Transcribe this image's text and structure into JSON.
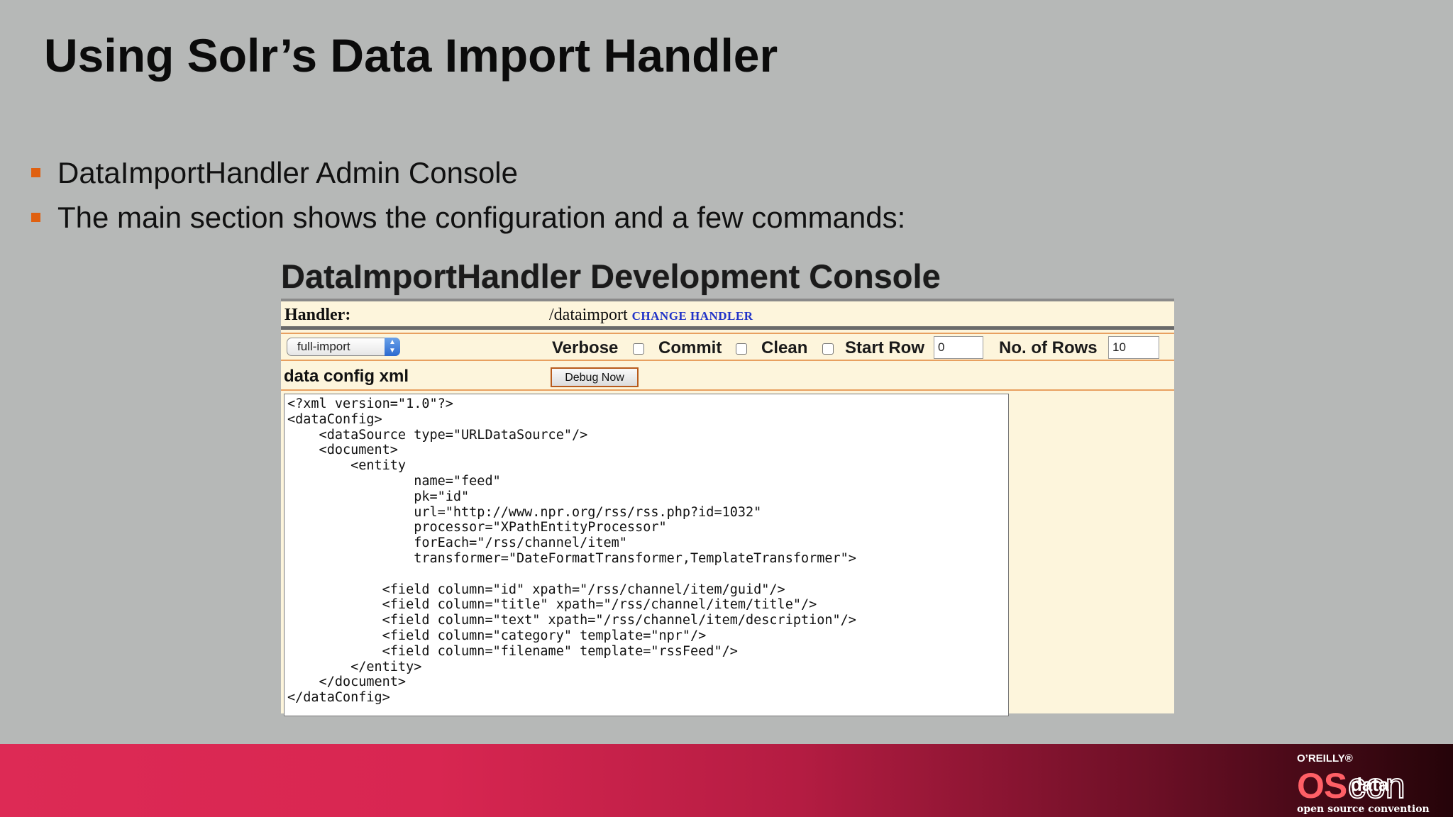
{
  "slide": {
    "title": "Using Solr’s Data Import Handler",
    "bullets": [
      "DataImportHandler Admin Console",
      "The main section shows the configuration and a few commands:"
    ]
  },
  "console": {
    "title": "DataImportHandler Development Console",
    "handler_label": "Handler:",
    "handler_path": "/dataimport",
    "change_handler_link": "CHANGE HANDLER",
    "command_select_value": "full-import",
    "verbose_label": "Verbose",
    "commit_label": "Commit",
    "clean_label": "Clean",
    "start_row_label": "Start Row",
    "start_row_value": "0",
    "rows_label": "No. of Rows",
    "rows_value": "10",
    "config_label": "data config xml",
    "debug_button": "Debug Now",
    "config_xml": "<?xml version=\"1.0\"?>\n<dataConfig>\n    <dataSource type=\"URLDataSource\"/>\n    <document>\n        <entity\n                name=\"feed\"\n                pk=\"id\"\n                url=\"http://www.npr.org/rss/rss.php?id=1032\"\n                processor=\"XPathEntityProcessor\"\n                forEach=\"/rss/channel/item\"\n                transformer=\"DateFormatTransformer,TemplateTransformer\">\n\n            <field column=\"id\" xpath=\"/rss/channel/item/guid\"/>\n            <field column=\"title\" xpath=\"/rss/channel/item/title\"/>\n            <field column=\"text\" xpath=\"/rss/channel/item/description\"/>\n            <field column=\"category\" template=\"npr\"/>\n            <field column=\"filename\" template=\"rssFeed\"/>\n        </entity>\n    </document>\n</dataConfig>"
  },
  "footer": {
    "logo_oreilly": "O’REILLY®",
    "logo_os": "OS",
    "logo_con": "con",
    "logo_data": "data",
    "logo_tagline": "open source convention"
  },
  "colors": {
    "background": "#b6b8b7",
    "bullet": "#e06010",
    "panel": "#fdf5dc",
    "link": "#2133c8",
    "footer_start": "#dd2a55",
    "footer_end": "#250409"
  }
}
